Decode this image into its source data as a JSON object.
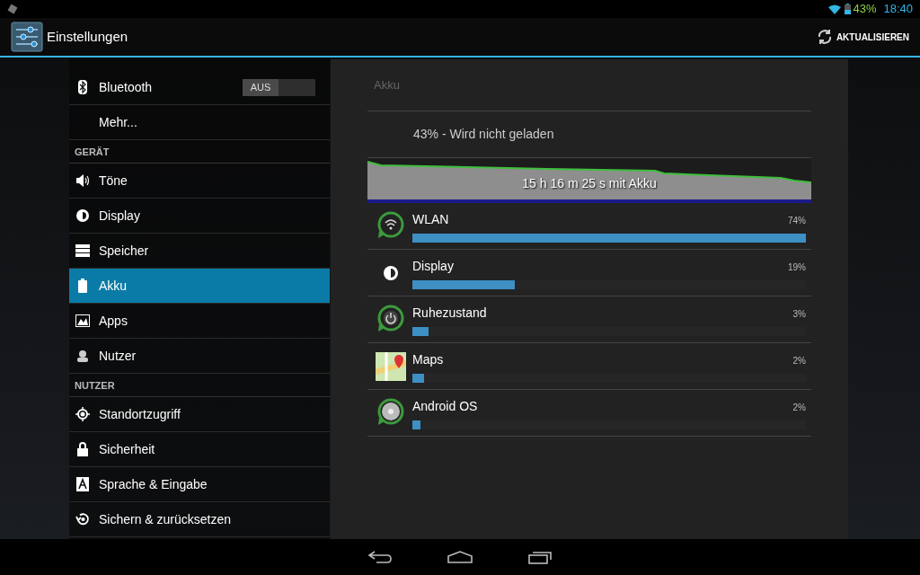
{
  "status_bar": {
    "battery": "43%",
    "time": "18:40"
  },
  "action_bar": {
    "title": "Einstellungen",
    "action": "AKTUALISIEREN"
  },
  "sidebar": {
    "items": [
      {
        "kind": "toggle",
        "label": "Bluetooth",
        "toggle_label": "AUS",
        "on": false,
        "selected": false
      },
      {
        "kind": "item",
        "label": "Mehr...",
        "selected": false
      },
      {
        "kind": "header",
        "label": "GERÄT"
      },
      {
        "kind": "item",
        "label": "Töne",
        "selected": false
      },
      {
        "kind": "item",
        "label": "Display",
        "selected": false
      },
      {
        "kind": "item",
        "label": "Speicher",
        "selected": false
      },
      {
        "kind": "item",
        "label": "Akku",
        "selected": true
      },
      {
        "kind": "item",
        "label": "Apps",
        "selected": false
      },
      {
        "kind": "item",
        "label": "Nutzer",
        "selected": false
      },
      {
        "kind": "header",
        "label": "NUTZER"
      },
      {
        "kind": "item",
        "label": "Standortzugriff",
        "selected": false
      },
      {
        "kind": "item",
        "label": "Sicherheit",
        "selected": false
      },
      {
        "kind": "item",
        "label": "Sprache & Eingabe",
        "selected": false
      },
      {
        "kind": "item",
        "label": "Sichern & zurücksetzen",
        "selected": false
      }
    ]
  },
  "battery_panel": {
    "title": "Akku",
    "status": "43% - Wird nicht geladen",
    "graph_label": "15 h 16 m 25 s mit Akku",
    "usage": [
      {
        "name": "WLAN",
        "percent": "74%",
        "level": 1.0
      },
      {
        "name": "Display",
        "percent": "19%",
        "level": 0.26
      },
      {
        "name": "Ruhezustand",
        "percent": "3%",
        "level": 0.04
      },
      {
        "name": "Maps",
        "percent": "2%",
        "level": 0.03
      },
      {
        "name": "Android OS",
        "percent": "2%",
        "level": 0.02
      }
    ]
  }
}
